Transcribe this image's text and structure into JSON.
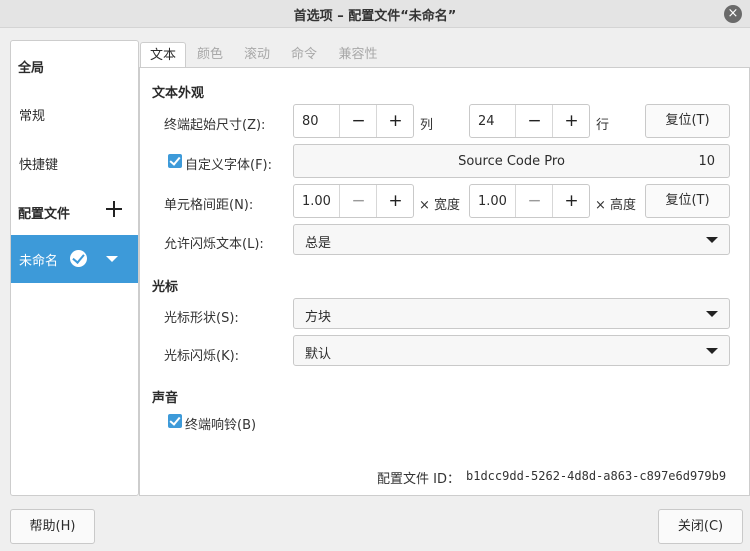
{
  "window": {
    "title": "首选项 – 配置文件“未命名”",
    "close_glyph": "×"
  },
  "sidebar": {
    "global_heading": "全局",
    "general": "常规",
    "shortcuts": "快捷键",
    "profiles_heading": "配置文件",
    "selected_profile": "未命名"
  },
  "tabs": [
    "文本",
    "颜色",
    "滚动",
    "命令",
    "兼容性"
  ],
  "text_appearance": {
    "heading": "文本外观",
    "initial_size_label": "终端起始尺寸(Z):",
    "columns_value": "80",
    "columns_unit": "列",
    "rows_value": "24",
    "rows_unit": "行",
    "reset_label": "复位(T)",
    "custom_font_label": "自定义字体(F):",
    "font_name": "Source Code Pro",
    "font_size": "10",
    "cell_spacing_label": "单元格间距(N):",
    "width_spacing": "1.00",
    "width_unit": "× 宽度",
    "height_spacing": "1.00",
    "height_unit": "× 高度",
    "reset2_label": "复位(T)",
    "blink_label": "允许闪烁文本(L):",
    "blink_value": "总是"
  },
  "cursor": {
    "heading": "光标",
    "shape_label": "光标形状(S):",
    "shape_value": "方块",
    "blink_label": "光标闪烁(K):",
    "blink_value": "默认"
  },
  "sound": {
    "heading": "声音",
    "bell_label": "终端响铃(B)"
  },
  "profile_id": {
    "label": "配置文件 ID：",
    "value": "b1dcc9dd-5262-4d8d-a863-c897e6d979b9"
  },
  "spin_symbols": {
    "minus": "−",
    "plus": "+"
  },
  "footer": {
    "help": "帮助(H)",
    "close": "关闭(C)"
  }
}
